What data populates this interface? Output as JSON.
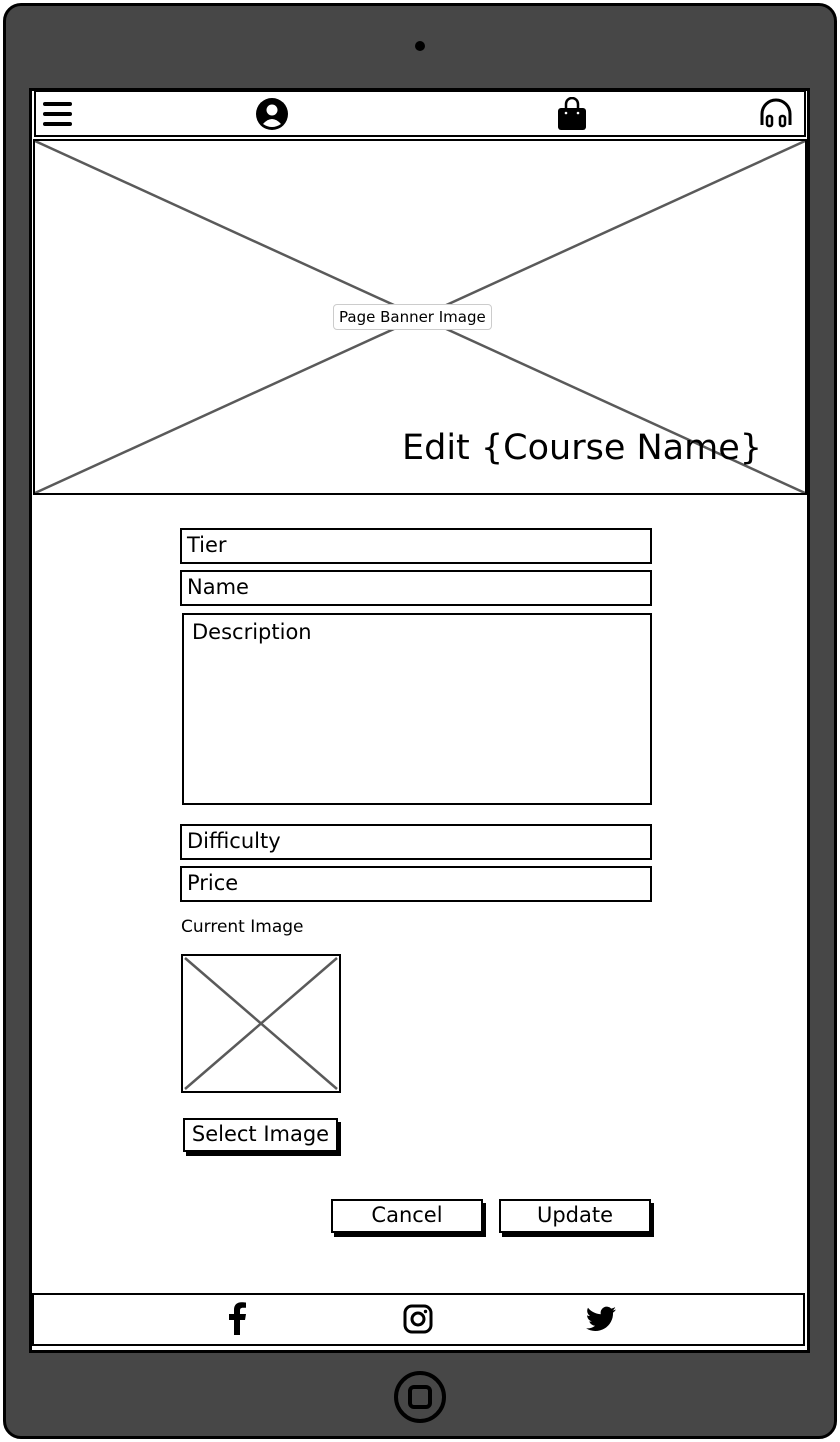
{
  "header": {
    "icons": [
      "menu-icon",
      "user-account-icon",
      "shopping-bag-icon",
      "headphones-icon"
    ]
  },
  "banner": {
    "placeholder_label": "Page Banner Image",
    "title": "Edit {Course Name}"
  },
  "form": {
    "tier_placeholder": "Tier",
    "name_placeholder": "Name",
    "description_placeholder": "Description",
    "difficulty_placeholder": "Difficulty",
    "price_placeholder": "Price",
    "current_image_label": "Current Image",
    "select_image_label": "Select Image",
    "cancel_label": "Cancel",
    "update_label": "Update"
  },
  "footer": {
    "icons": [
      "facebook-icon",
      "instagram-icon",
      "twitter-icon"
    ]
  },
  "colors": {
    "device": "#474747",
    "placeholder_lines": "#5a5a5a"
  }
}
